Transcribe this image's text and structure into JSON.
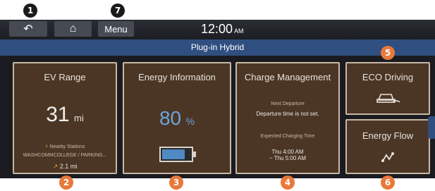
{
  "topbar": {
    "back_label": "↶",
    "home_label": "⌂",
    "menu_label": "Menu",
    "time": "12:00",
    "ampm": "AM"
  },
  "title": "Plug-in Hybrid",
  "ev_range": {
    "title": "EV Range",
    "value": "31",
    "unit": "mi",
    "nearby_label": "Nearby Stations",
    "station": "WASHCOMMCOLLEGE / PARKING...",
    "distance": "2.1 mi"
  },
  "energy_info": {
    "title": "Energy Information",
    "value": "80",
    "unit": "%",
    "battery_level": 0.8
  },
  "charge_mgmt": {
    "title": "Charge Management",
    "next_departure_label": "Next Departure",
    "next_departure_value": "Departure time is not set.",
    "expected_label": "Expected Charging Time",
    "expected_line1": "Thu 4:00 AM",
    "expected_line2": "~ Thu 5:00 AM"
  },
  "eco_driving": {
    "title": "ECO Driving",
    "icon": "car-gauge-icon"
  },
  "energy_flow": {
    "title": "Energy Flow",
    "icon": "flow-icon"
  },
  "markers": [
    "1",
    "2",
    "3",
    "4",
    "5",
    "6",
    "7"
  ],
  "colors": {
    "tile_bg": "#4b3626",
    "tile_border": "#c8b8a6",
    "title_bar": "#2f4f80",
    "battery_fill": "#4f8ac4",
    "marker_orange": "#e8793a",
    "accent_yellow": "#e6a23c"
  }
}
